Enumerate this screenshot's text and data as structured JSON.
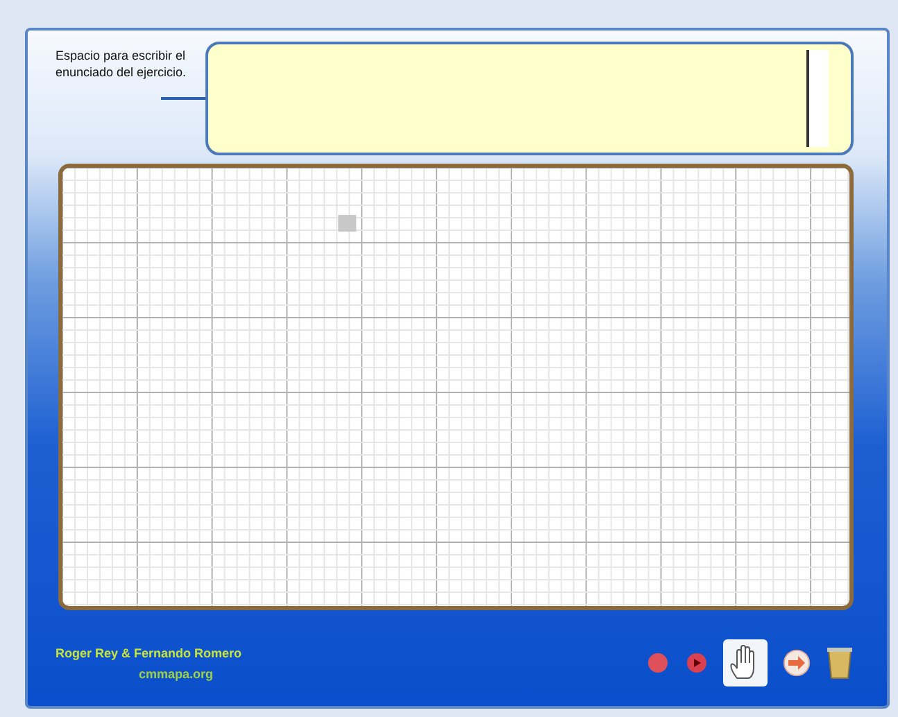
{
  "prompt_label": "Espacio para escribir el enunciado del ejercicio.",
  "footer": {
    "authors": "Roger Rey & Fernando Romero",
    "site": "cmmapa.org"
  },
  "tools": [
    {
      "kind": "dot"
    },
    {
      "kind": "dot-arrow"
    },
    {
      "kind": "hand",
      "selected": true
    },
    {
      "kind": "arrow",
      "selected": false
    },
    {
      "kind": "trash"
    }
  ]
}
